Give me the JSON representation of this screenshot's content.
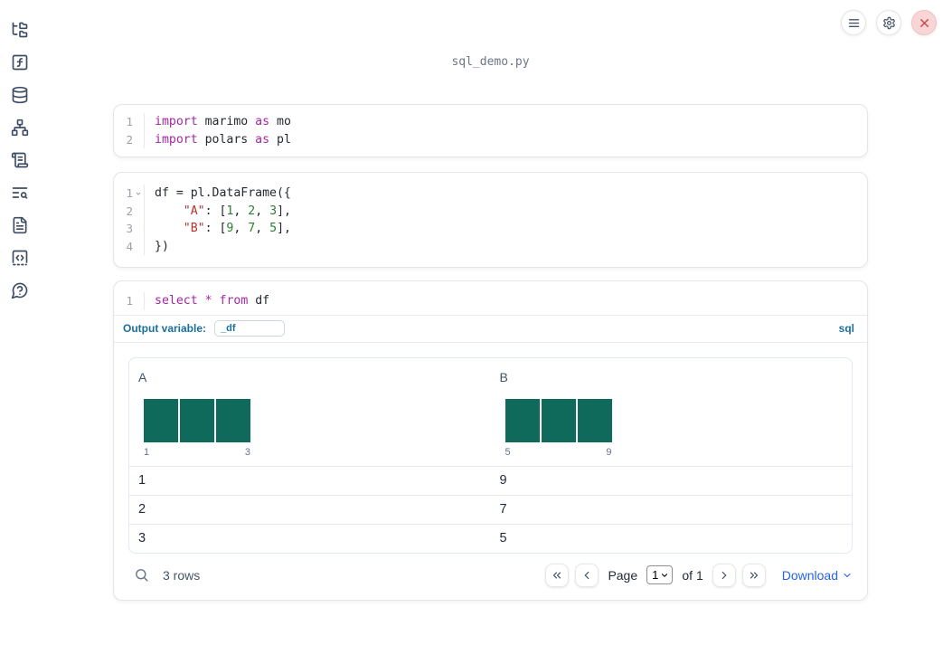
{
  "colors": {
    "accent_blue": "#1a6f9e",
    "link_blue": "#2563eb",
    "keyword": "#a626a4",
    "string": "#b03535",
    "number": "#2e7d32",
    "code_text": "#24292e",
    "bar_teal": "#106a5c",
    "close_red": "#cf4747"
  },
  "window": {
    "title": "sql_demo.py"
  },
  "topbar": {
    "buttons": [
      {
        "name": "menu",
        "icon": "hamburger-icon"
      },
      {
        "name": "settings",
        "icon": "gear-icon"
      },
      {
        "name": "close",
        "icon": "close-icon"
      }
    ]
  },
  "sidebar": {
    "items": [
      {
        "icon": "file-tree-icon"
      },
      {
        "icon": "function-icon"
      },
      {
        "icon": "database-icon"
      },
      {
        "icon": "dependency-graph-icon"
      },
      {
        "icon": "logs-icon"
      },
      {
        "icon": "text-search-icon"
      },
      {
        "icon": "document-icon"
      },
      {
        "icon": "snippets-icon"
      },
      {
        "icon": "help-icon"
      }
    ]
  },
  "cells": [
    {
      "lines": [
        {
          "num": "1",
          "tokens": [
            {
              "t": "import",
              "c": "kw"
            },
            {
              "t": " marimo ",
              "c": "pl"
            },
            {
              "t": "as",
              "c": "kw"
            },
            {
              "t": " mo",
              "c": "pl"
            }
          ]
        },
        {
          "num": "2",
          "tokens": [
            {
              "t": "import",
              "c": "kw"
            },
            {
              "t": " polars ",
              "c": "pl"
            },
            {
              "t": "as",
              "c": "kw"
            },
            {
              "t": " pl",
              "c": "pl"
            }
          ]
        }
      ]
    },
    {
      "lines": [
        {
          "num": "1",
          "fold": true,
          "tokens": [
            {
              "t": "df = pl.DataFrame({",
              "c": "pl"
            }
          ]
        },
        {
          "num": "2",
          "tokens": [
            {
              "t": "    ",
              "c": "pl"
            },
            {
              "t": "\"A\"",
              "c": "str"
            },
            {
              "t": ": [",
              "c": "pl"
            },
            {
              "t": "1",
              "c": "num"
            },
            {
              "t": ", ",
              "c": "pl"
            },
            {
              "t": "2",
              "c": "num"
            },
            {
              "t": ", ",
              "c": "pl"
            },
            {
              "t": "3",
              "c": "num"
            },
            {
              "t": "],",
              "c": "pl"
            }
          ]
        },
        {
          "num": "3",
          "tokens": [
            {
              "t": "    ",
              "c": "pl"
            },
            {
              "t": "\"B\"",
              "c": "str"
            },
            {
              "t": ": [",
              "c": "pl"
            },
            {
              "t": "9",
              "c": "num"
            },
            {
              "t": ", ",
              "c": "pl"
            },
            {
              "t": "7",
              "c": "num"
            },
            {
              "t": ", ",
              "c": "pl"
            },
            {
              "t": "5",
              "c": "num"
            },
            {
              "t": "],",
              "c": "pl"
            }
          ]
        },
        {
          "num": "4",
          "tokens": [
            {
              "t": "})",
              "c": "pl"
            }
          ]
        }
      ]
    },
    {
      "lines": [
        {
          "num": "1",
          "tokens": [
            {
              "t": "select",
              "c": "kw"
            },
            {
              "t": " ",
              "c": "pl"
            },
            {
              "t": "*",
              "c": "kw"
            },
            {
              "t": " ",
              "c": "pl"
            },
            {
              "t": "from",
              "c": "kw"
            },
            {
              "t": " df",
              "c": "pl"
            }
          ]
        }
      ]
    }
  ],
  "sql_cell": {
    "output_variable_label": "Output variable:",
    "output_variable_value": "_df",
    "language_label": "sql"
  },
  "output_table": {
    "columns": [
      {
        "name": "A",
        "histogram": {
          "bars": [
            1,
            1,
            1
          ],
          "min_label": "1",
          "max_label": "3"
        }
      },
      {
        "name": "B",
        "histogram": {
          "bars": [
            1,
            1,
            1
          ],
          "min_label": "5",
          "max_label": "9"
        }
      }
    ],
    "rows": [
      [
        "1",
        "9"
      ],
      [
        "2",
        "7"
      ],
      [
        "3",
        "5"
      ]
    ],
    "footer": {
      "row_count": "3 rows",
      "page_label": "Page",
      "page_value": "1",
      "of_label": "of 1",
      "download_label": "Download"
    }
  }
}
